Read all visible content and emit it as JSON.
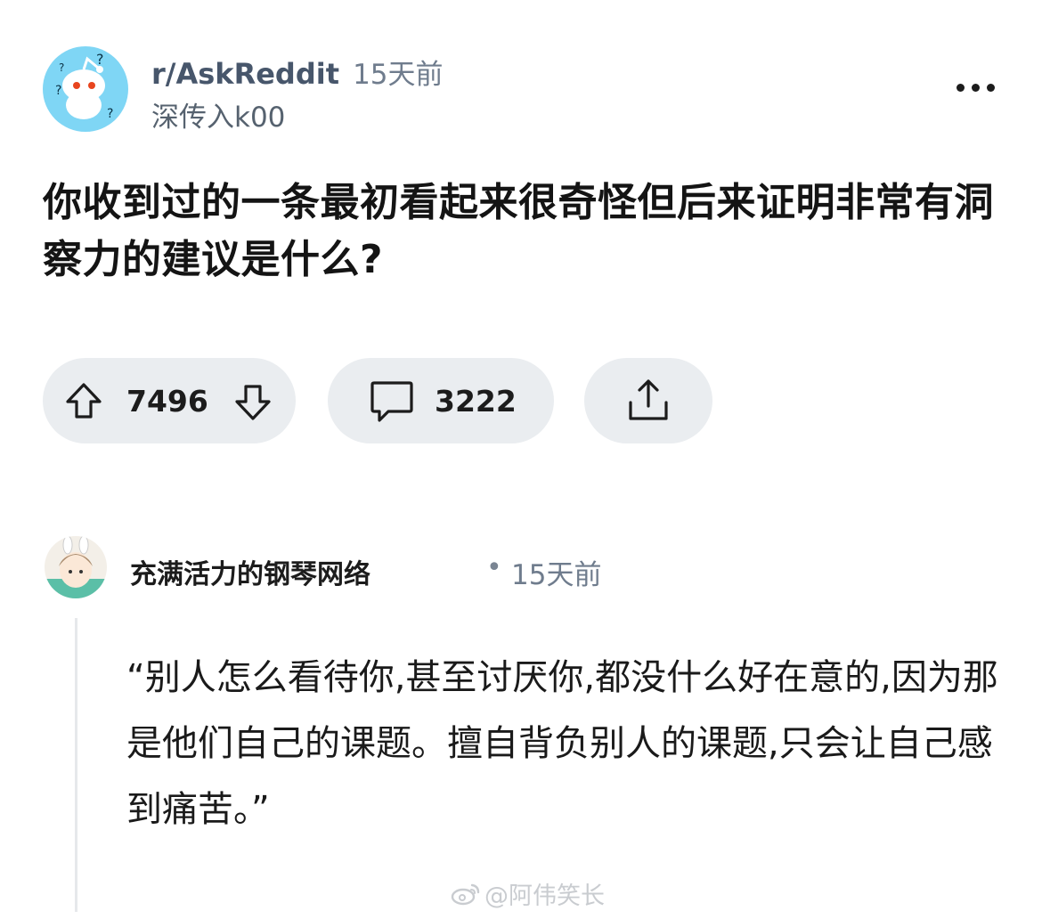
{
  "post": {
    "subreddit": "r/AskReddit",
    "time": "15天前",
    "author": "深传入k00",
    "title": "你收到过的一条最初看起来很奇怪但后来证明非常有洞察力的建议是什么?"
  },
  "actions": {
    "upvotes": "7496",
    "comments": "3222"
  },
  "comment": {
    "author": "充满活力的钢琴网络",
    "separator": "•",
    "time": "15天前",
    "body": "“别人怎么看待你,甚至讨厌你,都没什么好在意的,因为那是他们自己的课题。擅自背负别人的课题,只会让自己感到痛苦。”"
  },
  "watermark": {
    "text": "@阿伟笑长"
  },
  "colors": {
    "pill_background": "#eaedf0",
    "subreddit_avatar": "#7fd6f5",
    "secondary_text": "#6f7c8d"
  },
  "icons": {
    "more": "more-dots-icon",
    "upvote": "upvote-arrow-icon",
    "downvote": "downvote-arrow-icon",
    "comment": "comment-bubble-icon",
    "share": "share-icon",
    "watermark": "weibo-icon"
  }
}
